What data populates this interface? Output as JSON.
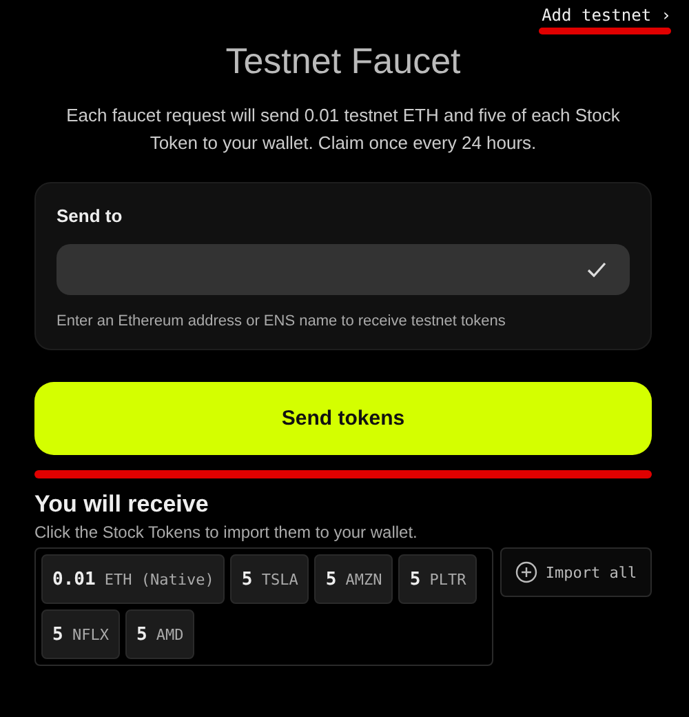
{
  "top_link": {
    "label": "Add testnet",
    "chevron": "›",
    "highlighted": true
  },
  "title": "Testnet Faucet",
  "description": "Each faucet request will send 0.01 testnet ETH and five of each Stock Token to your wallet. Claim once every 24 hours.",
  "send_card": {
    "label": "Send to",
    "field": {
      "valid": true
    },
    "helper": "Enter an Ethereum address or ENS name to receive testnet tokens"
  },
  "send_button": {
    "label": "Send tokens",
    "highlighted": true
  },
  "receive": {
    "heading": "You will receive",
    "subtitle": "Click the Stock Tokens to import them to your wallet.",
    "tokens": [
      {
        "amount": "0.01",
        "symbol": "ETH (Native)"
      },
      {
        "amount": "5",
        "symbol": "TSLA"
      },
      {
        "amount": "5",
        "symbol": "AMZN"
      },
      {
        "amount": "5",
        "symbol": "PLTR"
      },
      {
        "amount": "5",
        "symbol": "NFLX"
      },
      {
        "amount": "5",
        "symbol": "AMD"
      }
    ],
    "import_button": {
      "label": "Import all"
    }
  }
}
